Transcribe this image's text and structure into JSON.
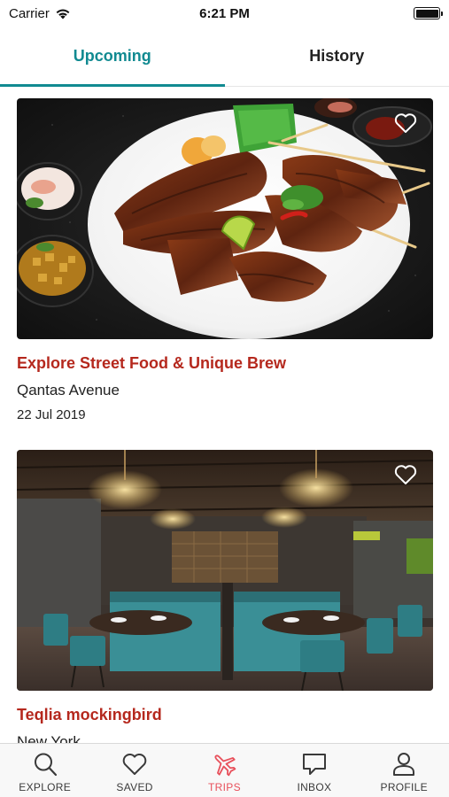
{
  "status_bar": {
    "carrier": "Carrier",
    "time": "6:21 PM"
  },
  "tabs": [
    {
      "label": "Upcoming",
      "active": true
    },
    {
      "label": "History",
      "active": false
    }
  ],
  "trips": [
    {
      "title": "Explore Street Food & Unique Brew",
      "location": "Qantas Avenue",
      "date": "22 Jul 2019",
      "image": "grilled-skewers-plate-photo",
      "favorited": false
    },
    {
      "title": "Teqlia mockingbird",
      "location": "New York",
      "image": "restaurant-interior-photo",
      "favorited": false
    }
  ],
  "bottom_nav": [
    {
      "label": "EXPLORE",
      "icon": "search-icon",
      "active": false
    },
    {
      "label": "SAVED",
      "icon": "heart-icon",
      "active": false
    },
    {
      "label": "TRIPS",
      "icon": "airplane-icon",
      "active": true
    },
    {
      "label": "INBOX",
      "icon": "chat-bubble-icon",
      "active": false
    },
    {
      "label": "PROFILE",
      "icon": "user-icon",
      "active": false
    }
  ],
  "colors": {
    "accent": "#118a91",
    "title_red": "#b5281d",
    "nav_active": "#e8505b"
  }
}
